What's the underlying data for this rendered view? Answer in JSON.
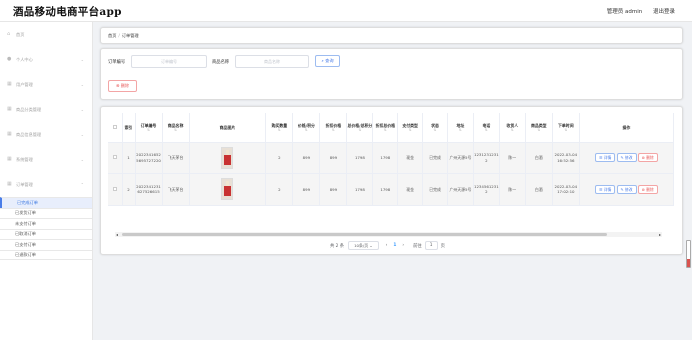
{
  "app": {
    "title": "酒品移动电商平台app"
  },
  "header": {
    "admin_label": "管理员 admin",
    "logout_label": "退出登录"
  },
  "sidebar": {
    "items": [
      {
        "label": "首页",
        "icon": "home-icon"
      },
      {
        "label": "个人中心",
        "icon": "user-icon"
      },
      {
        "label": "用户管理",
        "icon": "grid-icon"
      },
      {
        "label": "商品分类管理",
        "icon": "grid-icon"
      },
      {
        "label": "商品信息管理",
        "icon": "grid-icon"
      },
      {
        "label": "系统管理",
        "icon": "grid-icon"
      },
      {
        "label": "订单管理",
        "icon": "grid-icon"
      }
    ],
    "subitems": [
      "已完成订单",
      "已发货订单",
      "未支付订单",
      "已取消订单",
      "已支付订单",
      "已退款订单"
    ]
  },
  "breadcrumb": {
    "home": "首页",
    "sep": "/",
    "current": "订单管理"
  },
  "search": {
    "order_no_label": "订单编号",
    "order_no_placeholder": "订单编号",
    "product_label": "商品名称",
    "product_placeholder": "商品名称",
    "query_label": "查询",
    "delete_label": "删除"
  },
  "table": {
    "headers": [
      "索引",
      "订单编号",
      "商品名称",
      "商品图片",
      "购买数量",
      "价格/积分",
      "折扣价格",
      "总价格/总积分",
      "折扣总价格",
      "支付类型",
      "状态",
      "地址",
      "电话",
      "收货人",
      "商品类型",
      "下单时间",
      "操作"
    ],
    "sort_mark": "⇅",
    "rows": [
      {
        "index": "1",
        "order_no": "20223416525695727220",
        "product": "飞天茅台",
        "qty": "2",
        "price": "899",
        "discount": "899",
        "total": "1798",
        "discount_total": "1798",
        "pay_type": "现金",
        "status": "已完成",
        "address": "广州天源5号",
        "phone": "12312312312",
        "receiver": "陈一",
        "type": "白酒",
        "time": "2022-03-04 16:52:56"
      },
      {
        "index": "2",
        "order_no": "2022341231627526615",
        "product": "飞天茅台",
        "qty": "2",
        "price": "899",
        "discount": "899",
        "total": "1798",
        "discount_total": "1798",
        "pay_type": "现金",
        "status": "已完成",
        "address": "广州天源5号",
        "phone": "12345612312",
        "receiver": "陈一",
        "type": "白酒",
        "time": "2022-03-04 17:02:10"
      }
    ],
    "actions": {
      "detail": "详情",
      "edit": "修改",
      "delete": "删除"
    }
  },
  "pagination": {
    "total": "共 2 条",
    "page_size": "10条/页",
    "prev": "‹",
    "current": "1",
    "next": "›",
    "goto_label": "前往",
    "goto_value": "1",
    "page_unit": "页"
  },
  "colors": {
    "primary": "#409eff",
    "danger": "#e85a5a",
    "active_bg": "#e8eefc"
  }
}
